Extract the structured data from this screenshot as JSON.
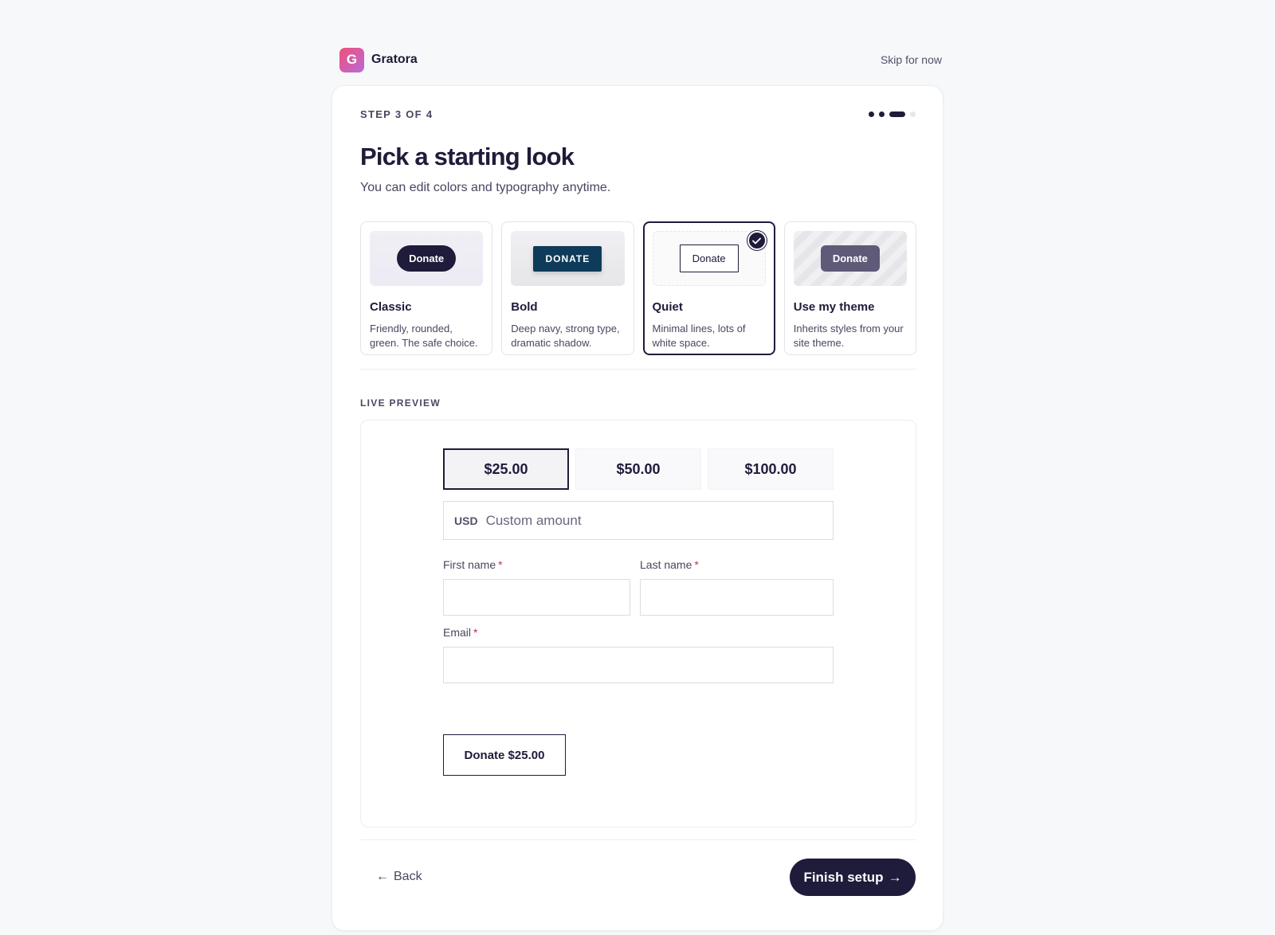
{
  "header": {
    "logo_letter": "G",
    "brand_name": "Gratora",
    "skip_label": "Skip for now"
  },
  "wizard": {
    "step_label": "STEP 3 OF 4",
    "title": "Pick a starting look",
    "subtitle": "You can edit colors and typography anytime.",
    "total_steps": 4,
    "current_step": 3
  },
  "themes": [
    {
      "button": "Donate",
      "name": "Classic",
      "desc": "Friendly, rounded, green. The safe choice.",
      "selected": false
    },
    {
      "button": "DONATE",
      "name": "Bold",
      "desc": "Deep navy, strong type, dramatic shadow.",
      "selected": false
    },
    {
      "button": "Donate",
      "name": "Quiet",
      "desc": "Minimal lines, lots of white space.",
      "selected": true
    },
    {
      "button": "Donate",
      "name": "Use my theme",
      "desc": "Inherits styles from your site theme.",
      "selected": false
    }
  ],
  "check_icon": "check-icon",
  "preview": {
    "label": "LIVE PREVIEW",
    "amounts": [
      "$25.00",
      "$50.00",
      "$100.00"
    ],
    "selected_amount": "$25.00",
    "currency": "USD",
    "custom_placeholder": "Custom amount",
    "first_name_label": "First name",
    "last_name_label": "Last name",
    "email_label": "Email",
    "required_mark": "*",
    "first_name_value": "",
    "last_name_value": "",
    "email_value": "",
    "submit_label": "Donate $25.00"
  },
  "footer": {
    "back_arrow": "←",
    "back_label": "Back",
    "finish_label": "Finish setup",
    "finish_arrow": "→"
  },
  "colors": {
    "primary": "#1f1b3a",
    "bold_navy": "#0f3b5a",
    "required": "#c0305a",
    "page_bg": "#f7f8fa"
  }
}
